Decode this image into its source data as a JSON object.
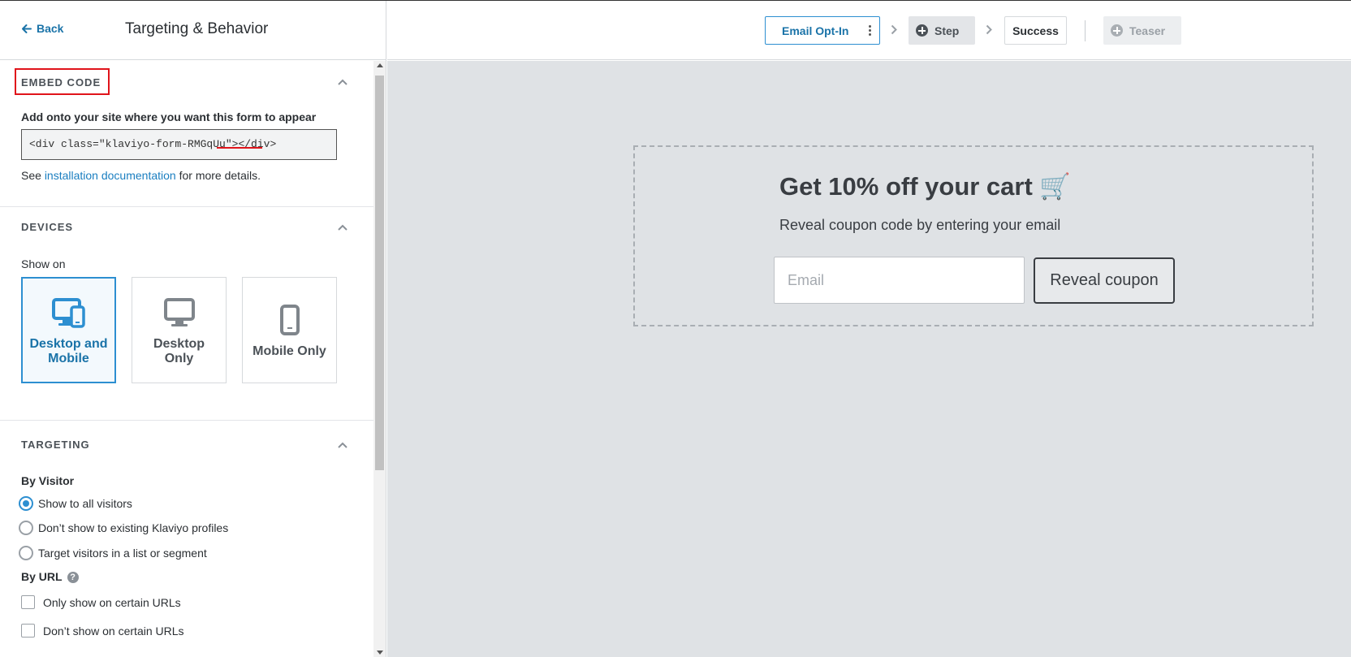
{
  "header": {
    "back_label": "Back",
    "title": "Targeting & Behavior"
  },
  "embed": {
    "section_title": "EMBED CODE",
    "instruction": "Add onto your site where you want this form to appear",
    "code": "<div class=\"klaviyo-form-RMGqUu\"></div>",
    "see_prefix": "See ",
    "doc_link": "installation documentation",
    "see_suffix": " for more details."
  },
  "devices": {
    "section_title": "DEVICES",
    "show_on_label": "Show on",
    "options": [
      {
        "label": "Desktop and Mobile",
        "selected": true
      },
      {
        "label": "Desktop Only",
        "selected": false
      },
      {
        "label": "Mobile Only",
        "selected": false
      }
    ]
  },
  "targeting": {
    "section_title": "TARGETING",
    "by_visitor_label": "By Visitor",
    "visitor_options": [
      {
        "label": "Show to all visitors",
        "selected": true
      },
      {
        "label": "Don’t show to existing Klaviyo profiles",
        "selected": false
      },
      {
        "label": "Target visitors in a list or segment",
        "selected": false
      }
    ],
    "by_url_label": "By URL",
    "url_options": [
      {
        "label": "Only show on certain URLs",
        "checked": false
      },
      {
        "label": "Don’t show on certain URLs",
        "checked": false
      }
    ]
  },
  "steps": {
    "email_optin": "Email Opt-In",
    "step": "Step",
    "success": "Success",
    "teaser": "Teaser"
  },
  "preview": {
    "title": "Get 10% off your cart 🛒",
    "subtitle": "Reveal coupon code by entering your email",
    "email_placeholder": "Email",
    "button_label": "Reveal coupon"
  },
  "colors": {
    "accent": "#2d8fd1",
    "link": "#1a7ec0",
    "highlight": "#e0141b",
    "canvas_bg": "#dfe2e5"
  }
}
